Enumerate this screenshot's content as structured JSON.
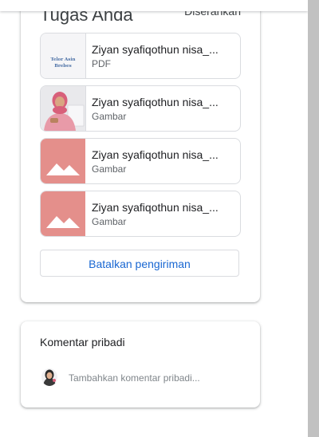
{
  "work": {
    "title": "Tugas Anda",
    "status": "Diserahkan",
    "attachments": [
      {
        "name": "Ziyan syafiqothun nisa_...",
        "type": "PDF",
        "thumb": "pdf-document-thumbnail",
        "thumb_text": [
          "Telor Asin",
          "Brebes"
        ]
      },
      {
        "name": "Ziyan syafiqothun nisa_...",
        "type": "Gambar",
        "thumb": "photo-thumbnail"
      },
      {
        "name": "Ziyan syafiqothun nisa_...",
        "type": "Gambar",
        "thumb": "image-placeholder-icon"
      },
      {
        "name": "Ziyan syafiqothun nisa_...",
        "type": "Gambar",
        "thumb": "image-placeholder-icon"
      }
    ],
    "unsubmit_label": "Batalkan pengiriman"
  },
  "comments": {
    "title": "Komentar pribadi",
    "placeholder": "Tambahkan komentar pribadi..."
  },
  "colors": {
    "accent": "#1967d2",
    "image_placeholder": "#e48f8b",
    "border": "#dadce0",
    "secondary_text": "#5f6368"
  }
}
